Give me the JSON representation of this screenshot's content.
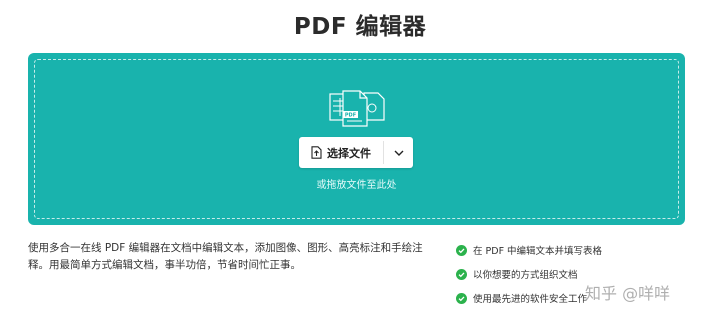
{
  "page": {
    "title": "PDF 编辑器"
  },
  "dropzone": {
    "icon": "files-icon",
    "choose_button_label": "选择文件",
    "choose_button_icon": "file-upload-icon",
    "dropdown_icon": "chevron-down-icon",
    "hint": "或拖放文件至此处",
    "background_color": "#19b3ad"
  },
  "description": {
    "text": "使用多合一在线 PDF 编辑器在文档中编辑文本，添加图像、图形、高亮标注和手绘注释。用最简单方式编辑文档，事半功倍，节省时间忙正事。"
  },
  "features": {
    "check_icon": "check-circle-icon",
    "check_color": "#2bb24c",
    "items": [
      {
        "label": "在 PDF 中编辑文本并填写表格"
      },
      {
        "label": "以你想要的方式组织文档"
      },
      {
        "label": "使用最先进的软件安全工作"
      }
    ]
  },
  "watermark": {
    "text": "知乎 @咩咩"
  }
}
